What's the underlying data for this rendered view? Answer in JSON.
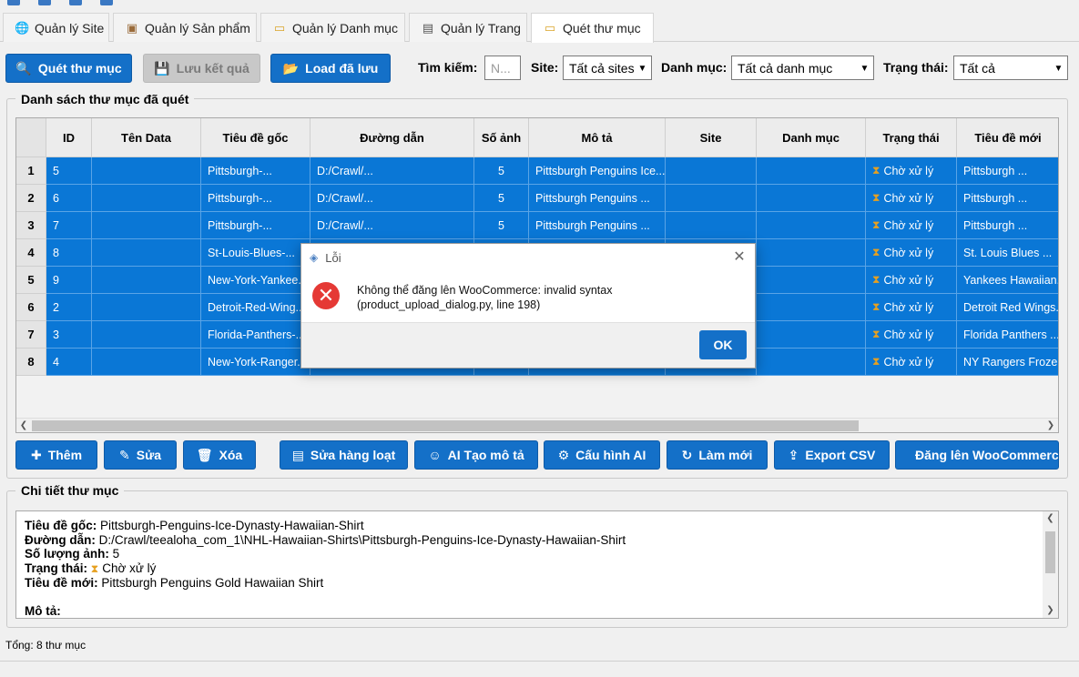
{
  "tabs": [
    {
      "label": "Quản lý Site",
      "icon": "globe-icon"
    },
    {
      "label": "Quản lý Sản phẩm",
      "icon": "box-icon"
    },
    {
      "label": "Quản lý Danh mục",
      "icon": "folder-icon"
    },
    {
      "label": "Quản lý Trang",
      "icon": "page-icon"
    },
    {
      "label": "Quét thư mục",
      "icon": "folder-icon"
    }
  ],
  "toolbar": {
    "scan_label": "Quét thư mục",
    "save_label": "Lưu kết quả",
    "load_label": "Load đã lưu",
    "search_label": "Tìm kiếm:",
    "search_placeholder": "N...",
    "site_label": "Site:",
    "site_value": "Tất cả sites",
    "category_label": "Danh mục:",
    "category_value": "Tất cả danh mục",
    "status_label": "Trạng thái:",
    "status_value": "Tất cả"
  },
  "list_group_title": "Danh sách thư mục đã quét",
  "table": {
    "columns": [
      "ID",
      "Tên Data",
      "Tiêu đề gốc",
      "Đường dẫn",
      "Số ảnh",
      "Mô tả",
      "Site",
      "Danh mục",
      "Trạng thái",
      "Tiêu đề mới"
    ],
    "rows": [
      {
        "num": "1",
        "cells": [
          "5",
          "",
          "Pittsburgh-...",
          "D:/Crawl/...",
          "5",
          "Pittsburgh Penguins Ice...",
          "",
          "",
          "Chờ xử lý",
          "Pittsburgh ..."
        ]
      },
      {
        "num": "2",
        "cells": [
          "6",
          "",
          "Pittsburgh-...",
          "D:/Crawl/...",
          "5",
          "Pittsburgh Penguins ...",
          "",
          "",
          "Chờ xử lý",
          "Pittsburgh ..."
        ]
      },
      {
        "num": "3",
        "cells": [
          "7",
          "",
          "Pittsburgh-...",
          "D:/Crawl/...",
          "5",
          "Pittsburgh Penguins ...",
          "",
          "",
          "Chờ xử lý",
          "Pittsburgh ..."
        ]
      },
      {
        "num": "4",
        "cells": [
          "8",
          "",
          "St-Louis-Blues-...",
          "",
          "",
          "",
          "",
          "",
          "Chờ xử lý",
          "St. Louis Blues ..."
        ]
      },
      {
        "num": "5",
        "cells": [
          "9",
          "",
          "New-York-Yankee...",
          "",
          "",
          "",
          "",
          "",
          "Chờ xử lý",
          "Yankees Hawaiian..."
        ]
      },
      {
        "num": "6",
        "cells": [
          "2",
          "",
          "Detroit-Red-Wing...",
          "",
          "",
          "",
          "",
          "",
          "Chờ xử lý",
          "Detroit Red Wings..."
        ]
      },
      {
        "num": "7",
        "cells": [
          "3",
          "",
          "Florida-Panthers-...",
          "",
          "",
          "",
          "",
          "",
          "Chờ xử lý",
          "Florida Panthers ..."
        ]
      },
      {
        "num": "8",
        "cells": [
          "4",
          "",
          "New-York-Ranger...",
          "",
          "",
          "",
          "",
          "",
          "Chờ xử lý",
          "NY Rangers Froze..."
        ]
      }
    ]
  },
  "actions": {
    "add": "Thêm",
    "edit": "Sửa",
    "delete": "Xóa",
    "bulk_edit": "Sửa hàng loạt",
    "ai_desc": "AI Tạo mô tả",
    "ai_config": "Cấu hình AI",
    "refresh": "Làm mới",
    "export_csv": "Export CSV",
    "upload_woo": "Đăng lên WooCommerce"
  },
  "detail": {
    "group_title": "Chi tiết thư mục",
    "orig_title_label": "Tiêu đề gốc:",
    "orig_title_value": "Pittsburgh-Penguins-Ice-Dynasty-Hawaiian-Shirt",
    "path_label": "Đường dẫn:",
    "path_value": "D:/Crawl/teealoha_com_1\\NHL-Hawaiian-Shirts\\Pittsburgh-Penguins-Ice-Dynasty-Hawaiian-Shirt",
    "image_count_label": "Số lượng ảnh:",
    "image_count_value": "5",
    "status_label": "Trạng thái:",
    "status_value": "Chờ xử lý",
    "new_title_label": "Tiêu đề mới:",
    "new_title_value": "Pittsburgh Penguins Gold Hawaiian Shirt",
    "desc_label": "Mô tả:"
  },
  "status_bar": {
    "total": "Tổng: 8 thư mục"
  },
  "dialog": {
    "title": "Lỗi",
    "message": "Không thể đăng lên WooCommerce: invalid syntax (product_upload_dialog.py, line 198)",
    "ok_label": "OK"
  },
  "colors": {
    "accent": "#1470c8",
    "selection": "#0a77d6",
    "error": "#e53935",
    "pending": "#e6a020"
  }
}
